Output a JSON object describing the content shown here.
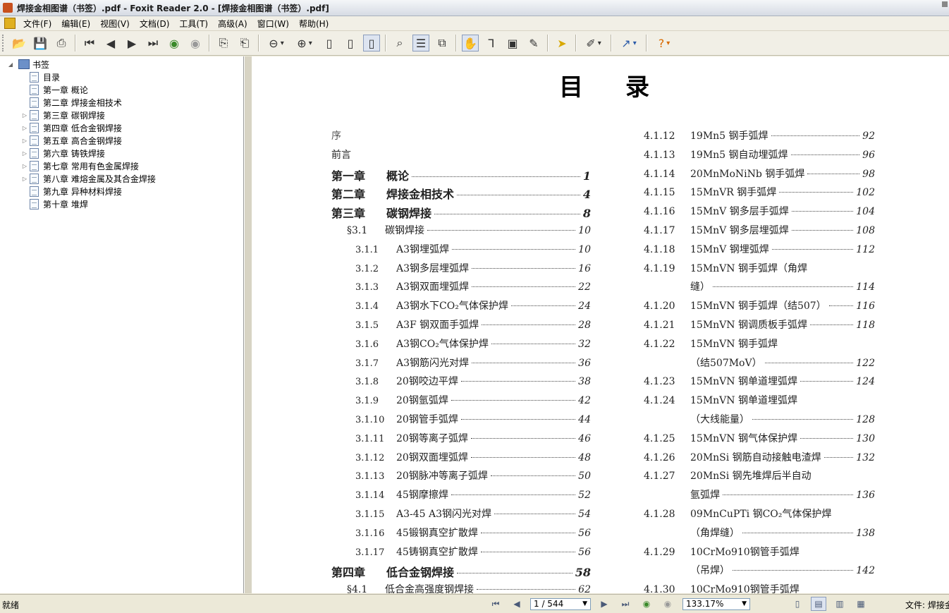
{
  "window": {
    "title": "焊接金相图谱（书签）.pdf - Foxit Reader 2.0 - [焊接金相图谱（书签）.pdf]"
  },
  "menu": [
    "文件(F)",
    "编辑(E)",
    "视图(V)",
    "文档(D)",
    "工具(T)",
    "高级(A)",
    "窗口(W)",
    "帮助(H)"
  ],
  "toolbar": {
    "buttons": [
      "open-icon",
      "save-icon",
      "print-icon",
      "first-page-icon",
      "prev-page-icon",
      "next-page-icon",
      "last-page-icon",
      "back-icon",
      "forward-icon",
      "rotate-left-icon",
      "rotate-right-icon",
      "zoom-out-icon",
      "zoom-in-icon",
      "actual-size-icon",
      "fit-page-icon",
      "fit-width-icon",
      "find-icon",
      "bookmarks-panel-icon",
      "snapshot-icon",
      "hand-tool-icon",
      "text-select-icon",
      "image-select-icon",
      "typewriter-icon",
      "select-tool-icon",
      "annotation-icon",
      "arrow-tool-icon",
      "help-icon"
    ]
  },
  "sidebar": {
    "root": "书签",
    "items": [
      {
        "label": "目录",
        "expandable": false
      },
      {
        "label": "第一章 概论",
        "expandable": false
      },
      {
        "label": "第二章 焊接金相技术",
        "expandable": false
      },
      {
        "label": "第三章 碳钢焊接",
        "expandable": true
      },
      {
        "label": "第四章 低合金钢焊接",
        "expandable": true
      },
      {
        "label": "第五章 高合金钢焊接",
        "expandable": true
      },
      {
        "label": "第六章 铸铁焊接",
        "expandable": true
      },
      {
        "label": "第七章 常用有色金属焊接",
        "expandable": true
      },
      {
        "label": "第八章 难熔金属及其合金焊接",
        "expandable": true
      },
      {
        "label": "第九章 异种材料焊接",
        "expandable": false
      },
      {
        "label": "第十章 堆焊",
        "expandable": false
      }
    ]
  },
  "document": {
    "title": "目录",
    "left": [
      {
        "num": "",
        "label": "序",
        "page": "",
        "kind": "sec faint"
      },
      {
        "num": "",
        "label": "前言",
        "page": "",
        "kind": "sec"
      },
      {
        "num": "第一章",
        "label": "概论",
        "page": "1",
        "kind": "chap"
      },
      {
        "num": "第二章",
        "label": "焊接金相技术",
        "page": "4",
        "kind": "chap"
      },
      {
        "num": "第三章",
        "label": "碳钢焊接",
        "page": "8",
        "kind": "chap"
      },
      {
        "num": "§3.1",
        "label": "碳钢焊接",
        "page": "10",
        "kind": "sec"
      },
      {
        "num": "3.1.1",
        "label": "A3钢埋弧焊",
        "page": "10",
        "kind": "sec"
      },
      {
        "num": "3.1.2",
        "label": "A3钢多层埋弧焊",
        "page": "16",
        "kind": "sec"
      },
      {
        "num": "3.1.3",
        "label": "A3钢双面埋弧焊",
        "page": "22",
        "kind": "sec"
      },
      {
        "num": "3.1.4",
        "label": "A3钢水下CO₂气体保护焊",
        "page": "24",
        "kind": "sec"
      },
      {
        "num": "3.1.5",
        "label": "A3F 钢双面手弧焊",
        "page": "28",
        "kind": "sec"
      },
      {
        "num": "3.1.6",
        "label": "A3钢CO₂气体保护焊",
        "page": "32",
        "kind": "sec"
      },
      {
        "num": "3.1.7",
        "label": "A3钢筋闪光对焊",
        "page": "36",
        "kind": "sec"
      },
      {
        "num": "3.1.8",
        "label": "20钢咬边平焊",
        "page": "38",
        "kind": "sec"
      },
      {
        "num": "3.1.9",
        "label": "20钢氩弧焊",
        "page": "42",
        "kind": "sec"
      },
      {
        "num": "3.1.10",
        "label": "20钢管手弧焊",
        "page": "44",
        "kind": "sec"
      },
      {
        "num": "3.1.11",
        "label": "20钢等离子弧焊",
        "page": "46",
        "kind": "sec"
      },
      {
        "num": "3.1.12",
        "label": "20钢双面埋弧焊",
        "page": "48",
        "kind": "sec"
      },
      {
        "num": "3.1.13",
        "label": "20钢脉冲等离子弧焊",
        "page": "50",
        "kind": "sec"
      },
      {
        "num": "3.1.14",
        "label": "45钢摩擦焊",
        "page": "52",
        "kind": "sec"
      },
      {
        "num": "3.1.15",
        "label": "A3-45 A3钢闪光对焊",
        "page": "54",
        "kind": "sec"
      },
      {
        "num": "3.1.16",
        "label": "45锻钢真空扩散焊",
        "page": "56",
        "kind": "sec"
      },
      {
        "num": "3.1.17",
        "label": "45铸钢真空扩散焊",
        "page": "56",
        "kind": "sec"
      },
      {
        "num": "第四章",
        "label": "低合金钢焊接",
        "page": "58",
        "kind": "chap"
      },
      {
        "num": "§4.1",
        "label": "低合金高强度钢焊接",
        "page": "62",
        "kind": "sec"
      }
    ],
    "right": [
      {
        "num": "4.1.12",
        "label": "19Mn5 钢手弧焊",
        "page": "92"
      },
      {
        "num": "4.1.13",
        "label": "19Mn5 钢自动埋弧焊",
        "page": "96"
      },
      {
        "num": "4.1.14",
        "label": "20MnMoNiNb 钢手弧焊",
        "page": "98"
      },
      {
        "num": "4.1.15",
        "label": "15MnVR 钢手弧焊",
        "page": "102"
      },
      {
        "num": "4.1.16",
        "label": "15MnV 钢多层手弧焊",
        "page": "104"
      },
      {
        "num": "4.1.17",
        "label": "15MnV 钢多层埋弧焊",
        "page": "108"
      },
      {
        "num": "4.1.18",
        "label": "15MnV 钢埋弧焊",
        "page": "112"
      },
      {
        "num": "4.1.19",
        "label": "15MnVN 钢手弧焊（角焊",
        "page": ""
      },
      {
        "num": "",
        "label": "缝）",
        "page": "114"
      },
      {
        "num": "4.1.20",
        "label": "15MnVN 钢手弧焊（结507）",
        "page": "116"
      },
      {
        "num": "4.1.21",
        "label": "15MnVN 钢调质板手弧焊",
        "page": "118"
      },
      {
        "num": "4.1.22",
        "label": "15MnVN 钢手弧焊",
        "page": ""
      },
      {
        "num": "",
        "label": "（结507MoV）",
        "page": "122"
      },
      {
        "num": "4.1.23",
        "label": "15MnVN 钢单道埋弧焊",
        "page": "124"
      },
      {
        "num": "4.1.24",
        "label": "15MnVN 钢单道埋弧焊",
        "page": ""
      },
      {
        "num": "",
        "label": "（大线能量）",
        "page": "128"
      },
      {
        "num": "4.1.25",
        "label": "15MnVN 钢气体保护焊",
        "page": "130"
      },
      {
        "num": "4.1.26",
        "label": "20MnSi 钢筋自动接触电渣焊",
        "page": "132"
      },
      {
        "num": "4.1.27",
        "label": "20MnSi 钢先堆焊后半自动",
        "page": ""
      },
      {
        "num": "",
        "label": "氩弧焊",
        "page": "136"
      },
      {
        "num": "4.1.28",
        "label": "09MnCuPTi 钢CO₂气体保护焊",
        "page": ""
      },
      {
        "num": "",
        "label": "（角焊缝）",
        "page": "138"
      },
      {
        "num": "4.1.29",
        "label": "10CrMo910钢管手弧焊",
        "page": ""
      },
      {
        "num": "",
        "label": "（吊焊）",
        "page": "142"
      },
      {
        "num": "4.1.30",
        "label": "10CrMo910钢管手弧焊",
        "page": ""
      }
    ]
  },
  "status": {
    "ready": "就绪",
    "page": "1 / 544",
    "zoom": "133.17%",
    "file": "文件: 焊接金"
  }
}
